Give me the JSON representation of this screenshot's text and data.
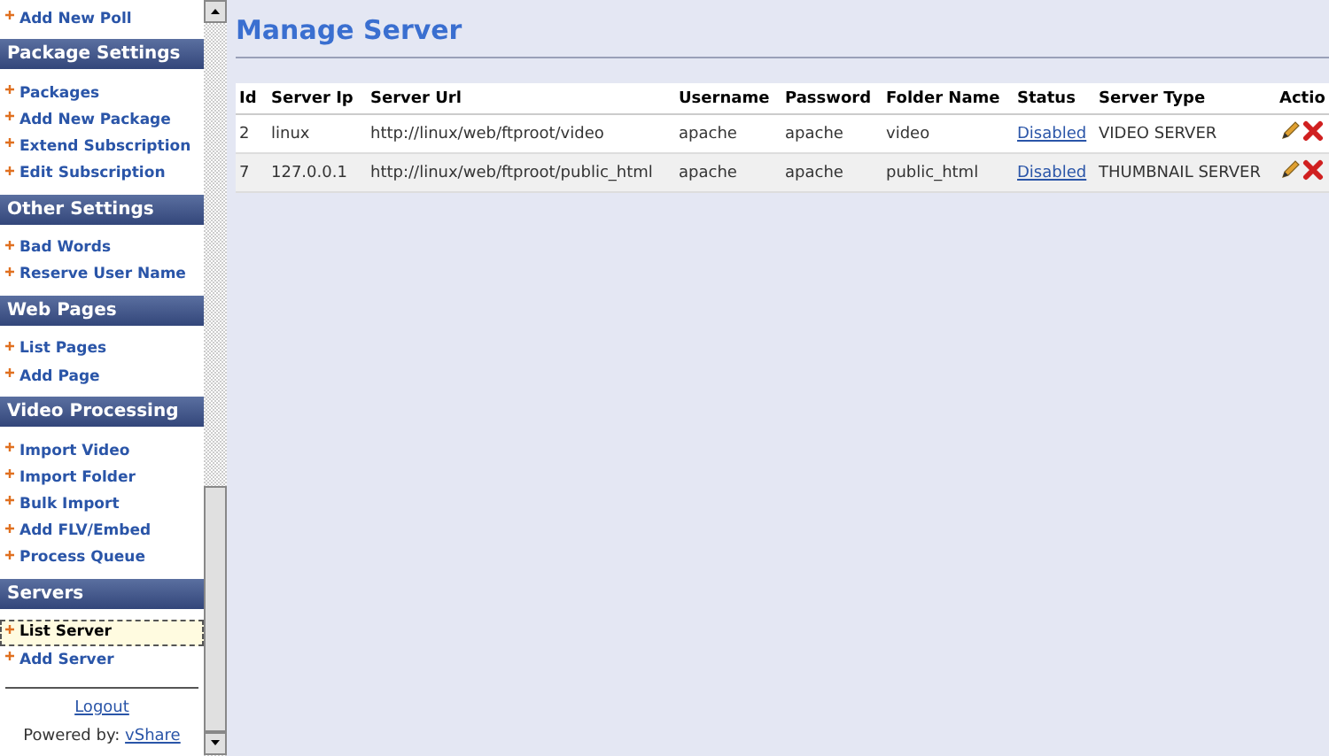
{
  "sidebar": {
    "sections": [
      {
        "items": [
          {
            "label": "Add New Poll",
            "selected": false
          }
        ]
      },
      {
        "title": "Package Settings",
        "items": [
          {
            "label": "Packages",
            "selected": false
          },
          {
            "label": "Add New Package",
            "selected": false
          },
          {
            "label": "Extend Subscription",
            "selected": false
          },
          {
            "label": "Edit Subscription",
            "selected": false
          }
        ]
      },
      {
        "title": "Other Settings",
        "items": [
          {
            "label": "Bad Words",
            "selected": false
          },
          {
            "label": "Reserve User Name",
            "selected": false
          }
        ]
      },
      {
        "title": "Web Pages",
        "items": [
          {
            "label": "List Pages",
            "selected": false
          },
          {
            "label": "Add Page",
            "selected": false
          }
        ]
      },
      {
        "title": "Video Processing",
        "items": [
          {
            "label": "Import Video",
            "selected": false
          },
          {
            "label": "Import Folder",
            "selected": false
          },
          {
            "label": "Bulk Import",
            "selected": false
          },
          {
            "label": "Add FLV/Embed",
            "selected": false
          },
          {
            "label": "Process Queue",
            "selected": false
          }
        ]
      },
      {
        "title": "Servers",
        "items": [
          {
            "label": "List Server",
            "selected": true
          },
          {
            "label": "Add Server",
            "selected": false
          }
        ]
      }
    ],
    "logout": "Logout",
    "powered_by": "Powered by:",
    "powered_link": "vShare"
  },
  "page_title": "Manage Server",
  "table": {
    "columns": [
      "Id",
      "Server Ip",
      "Server Url",
      "Username",
      "Password",
      "Folder Name",
      "Status",
      "Server Type",
      "Actio"
    ],
    "rows": [
      {
        "id": "2",
        "server_ip": "linux",
        "server_url": "http://linux/web/ftproot/video",
        "username": "apache",
        "password": "apache",
        "folder_name": "video",
        "status": "Disabled",
        "server_type": "VIDEO SERVER"
      },
      {
        "id": "7",
        "server_ip": "127.0.0.1",
        "server_url": "http://linux/web/ftproot/public_html",
        "username": "apache",
        "password": "apache",
        "folder_name": "public_html",
        "status": "Disabled",
        "server_type": "THUMBNAIL SERVER"
      }
    ]
  }
}
